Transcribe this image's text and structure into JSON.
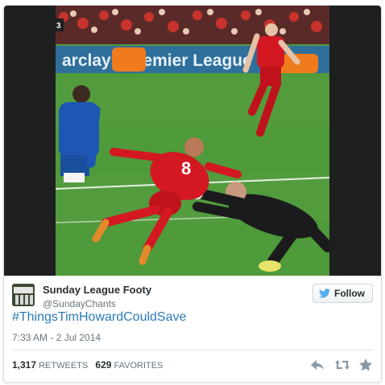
{
  "tweet": {
    "author_name": "Sunday League Footy",
    "author_handle": "@SundayChants",
    "follow_label": "Follow",
    "text": "#ThingsTimHowardCouldSave",
    "timestamp": "7:33 AM - 2 Jul 2014",
    "retweets_count": "1,317",
    "retweets_label": "RETWEETS",
    "favorites_count": "629",
    "favorites_label": "FAVORITES"
  },
  "media": {
    "corner_badge": "3",
    "banner_text": "arclays Premier League",
    "shirt_number": "8"
  },
  "icons": {
    "follow": "twitter-bird-icon",
    "reply": "reply-icon",
    "retweet": "retweet-icon",
    "favorite": "star-icon"
  },
  "colors": {
    "link": "#2b7bb9",
    "pitch": "#4f9a3a",
    "liverpool_red": "#d31822",
    "chelsea_blue": "#1d57b3"
  }
}
